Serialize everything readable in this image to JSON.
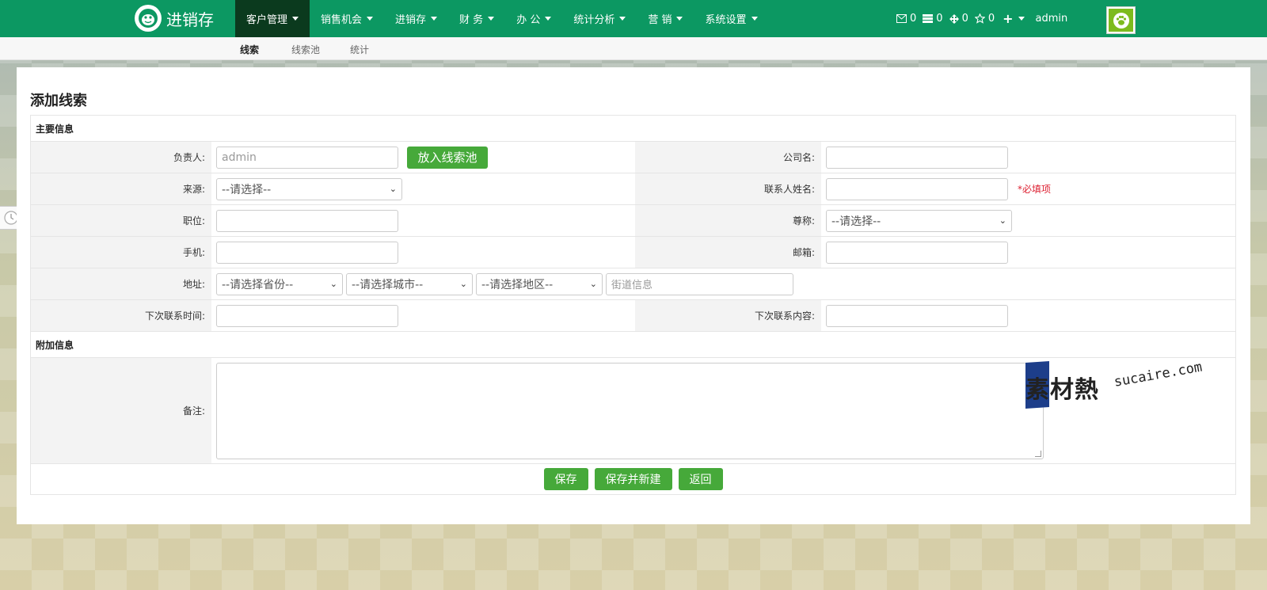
{
  "app": {
    "brand_text": "进销存"
  },
  "nav": {
    "items": [
      {
        "label": "客户管理",
        "active": true
      },
      {
        "label": "销售机会",
        "active": false
      },
      {
        "label": "进销存",
        "active": false
      },
      {
        "label": "财 务",
        "active": false
      },
      {
        "label": "办 公",
        "active": false
      },
      {
        "label": "统计分析",
        "active": false
      },
      {
        "label": "营 销",
        "active": false
      },
      {
        "label": "系统设置",
        "active": false
      }
    ]
  },
  "tools": {
    "messages": "0",
    "tasks": "0",
    "approvals": "0",
    "favorites": "0",
    "user_name": "admin"
  },
  "subnav": {
    "items": [
      "线索",
      "线索池",
      "统计"
    ]
  },
  "page": {
    "title": "添加线索"
  },
  "form": {
    "section_main": "主要信息",
    "owner_label": "负责人:",
    "owner_value": "admin",
    "pool_button": "放入线索池",
    "company_label": "公司名:",
    "source_label": "来源:",
    "source_value": "--请选择--",
    "contact_label": "联系人姓名:",
    "required_note": "*必填项",
    "position_label": "职位:",
    "salutation_label": "尊称:",
    "salutation_value": "--请选择--",
    "mobile_label": "手机:",
    "email_label": "邮箱:",
    "address_label": "地址:",
    "province_value": "--请选择省份--",
    "city_value": "--请选择城市--",
    "district_value": "--请选择地区--",
    "street_placeholder": "街道信息",
    "next_time_label": "下次联系时间:",
    "next_content_label": "下次联系内容:",
    "section_extra": "附加信息",
    "remark_label": "备注:"
  },
  "actions": {
    "save": "保存",
    "save_new": "保存并新建",
    "back": "返回"
  },
  "watermark": {
    "cn": "素材熱",
    "en": "sucaire.com"
  },
  "colors": {
    "nav_bg": "#0c9862",
    "nav_active": "#0b3a1e",
    "button_green": "#46a93a",
    "required_red": "#dd2233"
  }
}
